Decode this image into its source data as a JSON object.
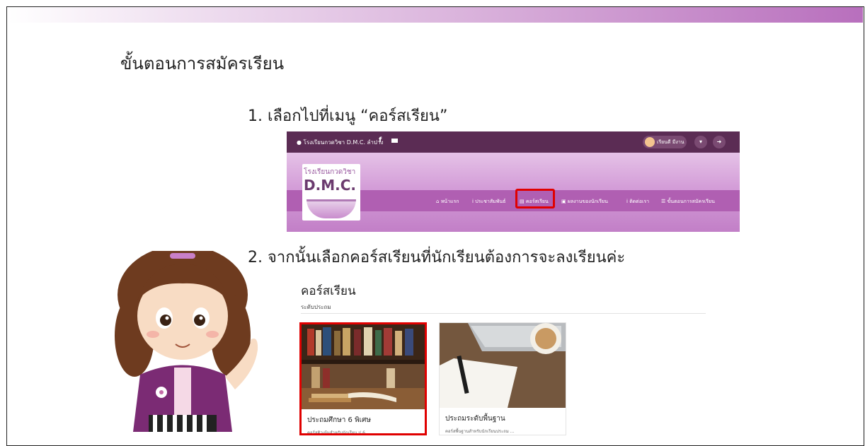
{
  "slide": {
    "title": "ขั้นตอนการสมัครเรียน",
    "step1": "1. เลือกไปที่เมนู “คอร์สเรียน”",
    "step2": "2. จากนั้นเลือกคอร์สเรียนที่นักเรียนต้องการจะลงเรียนค่ะ"
  },
  "site": {
    "address": "โรงเรียนกวดวิชา D.M.C. ลำปาง",
    "user_name": "เรียนดี มีงาน",
    "logo_line1": "โรงเรียนกวดวิชา",
    "logo_line2": "D.M.C.",
    "nav": [
      {
        "label": "หน้าแรก",
        "icon": "home-icon"
      },
      {
        "label": "ประชาสัมพันธ์",
        "icon": "info-icon"
      },
      {
        "label": "คอร์สเรียน",
        "icon": "book-icon"
      },
      {
        "label": "ผลงานของนักเรียน",
        "icon": "card-icon"
      },
      {
        "label": "ติดต่อเรา",
        "icon": "info-icon"
      },
      {
        "label": "ขั้นตอนการสมัครเรียน",
        "icon": "list-icon"
      }
    ]
  },
  "courses": {
    "heading": "คอร์สเรียน",
    "level": "ระดับประถม",
    "items": [
      {
        "title": "ประถมศึกษา 6 พิเศษ",
        "desc": "คอร์สติวเข้มสำหรับนักเรียน ป.6 ..."
      },
      {
        "title": "ประถมระดับพื้นฐาน",
        "desc": "คอร์สพื้นฐานสำหรับนักเรียนประถม ..."
      }
    ]
  },
  "colors": {
    "accent_highlight": "#e00000",
    "topbar": "#5b2c54",
    "navbar": "#b05fb2"
  }
}
